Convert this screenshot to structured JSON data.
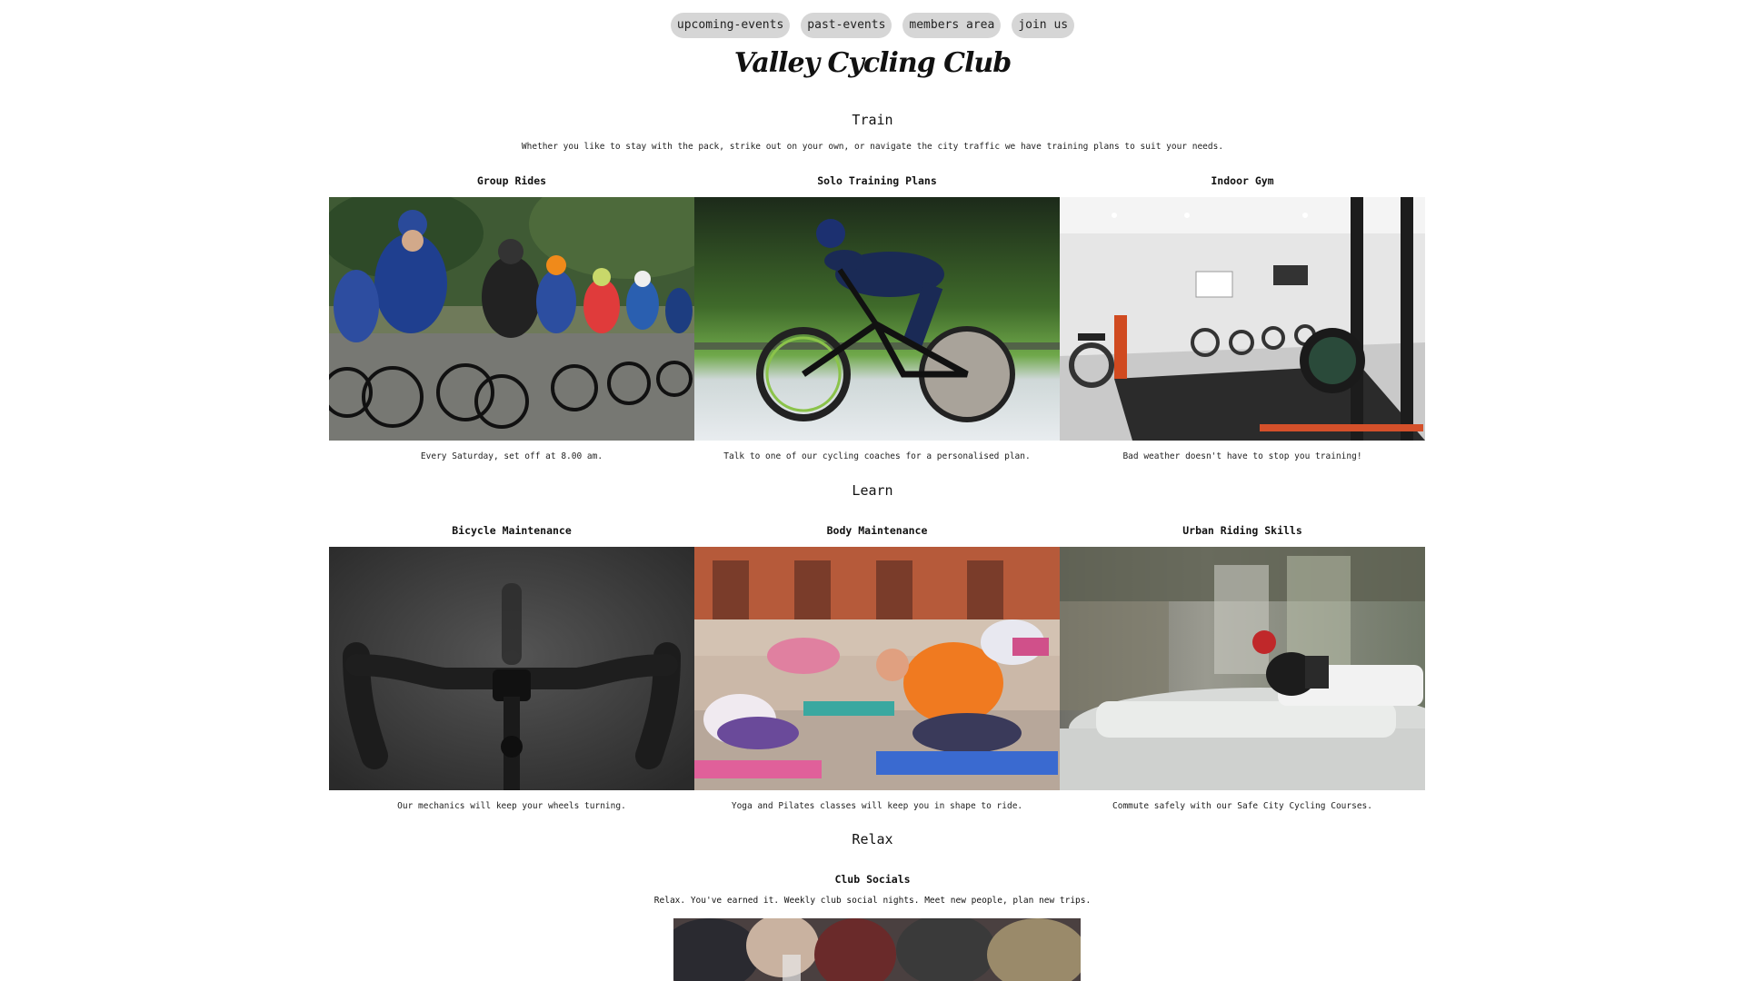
{
  "nav": {
    "items": [
      {
        "label": "upcoming-events"
      },
      {
        "label": "past-events"
      },
      {
        "label": "members area"
      },
      {
        "label": "join us"
      }
    ]
  },
  "site": {
    "title": "Valley Cycling Club"
  },
  "train": {
    "title": "Train",
    "intro": "Whether you like to stay with the pack, strike out on your own, or navigate the city traffic we have training plans to suit your needs.",
    "cards": [
      {
        "title": "Group Rides",
        "caption": "Every Saturday, set off at 8.00 am."
      },
      {
        "title": "Solo Training Plans",
        "caption": "Talk to one of our cycling coaches for a personalised plan."
      },
      {
        "title": "Indoor Gym",
        "caption": "Bad weather doesn't have to stop you training!"
      }
    ]
  },
  "learn": {
    "title": "Learn",
    "cards": [
      {
        "title": "Bicycle Maintenance",
        "caption": "Our mechanics will keep your wheels turning."
      },
      {
        "title": "Body Maintenance",
        "caption": "Yoga and Pilates classes will keep you in shape to ride."
      },
      {
        "title": "Urban Riding Skills",
        "caption": "Commute safely with our Safe City Cycling Courses."
      }
    ]
  },
  "relax": {
    "title": "Relax",
    "card": {
      "title": "Club Socials",
      "text": "Relax. You've earned it. Weekly club social nights. Meet new people, plan new trips."
    }
  }
}
